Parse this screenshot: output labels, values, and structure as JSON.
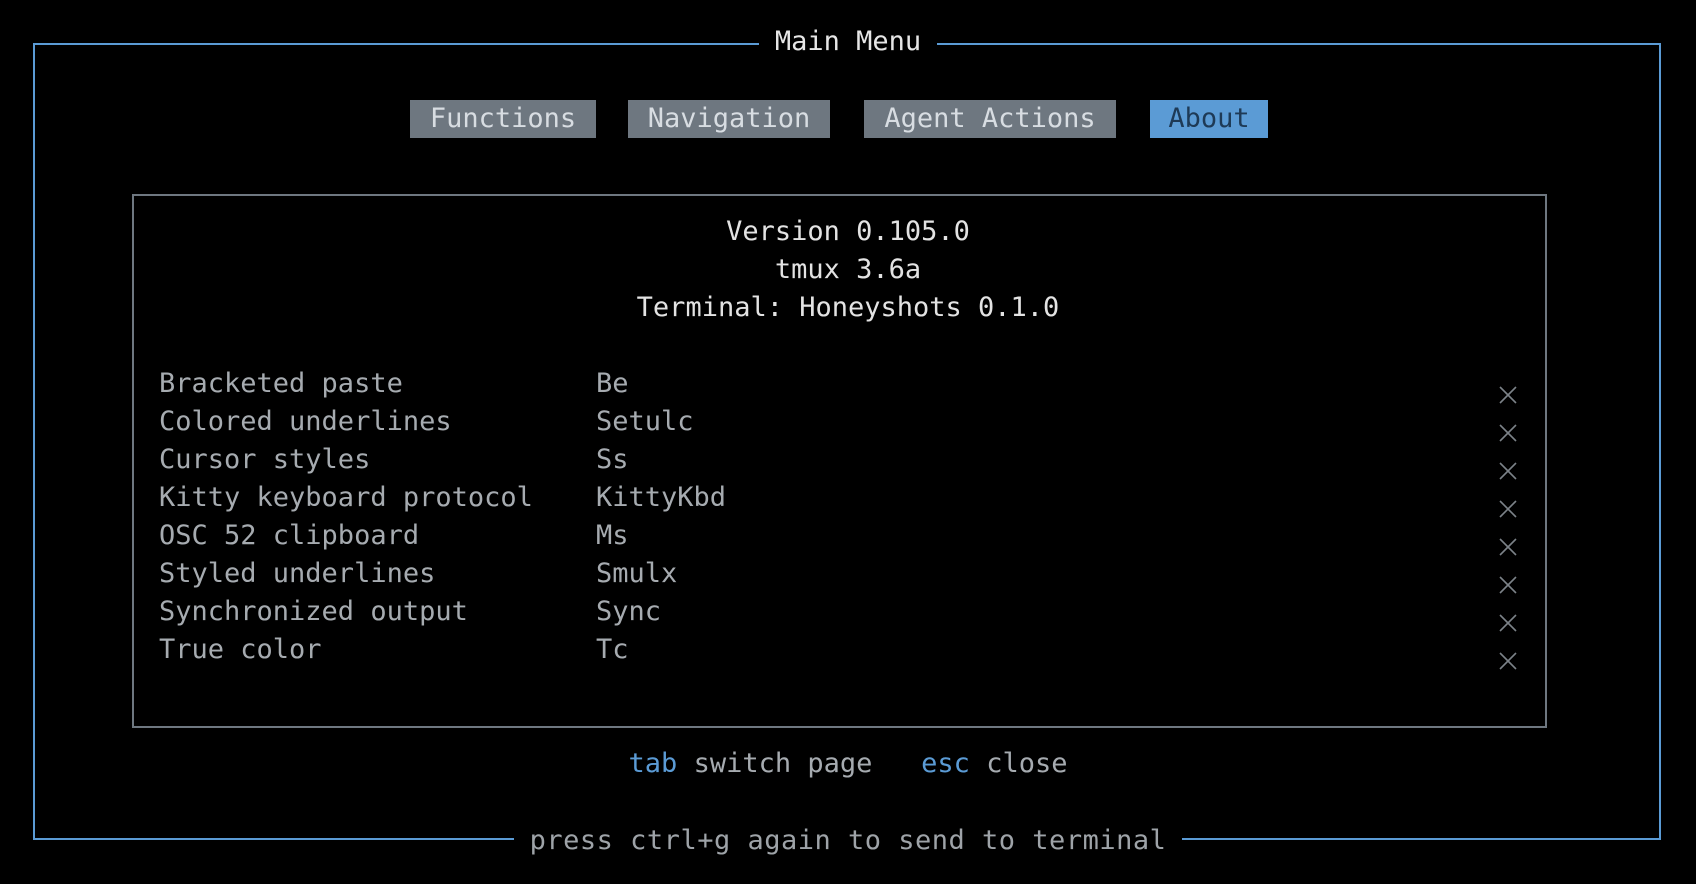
{
  "menu": {
    "title": "Main Menu",
    "footer": "press ctrl+g again to send to terminal"
  },
  "tabs": [
    {
      "label": "Functions",
      "active": false
    },
    {
      "label": "Navigation",
      "active": false
    },
    {
      "label": "Agent Actions",
      "active": false
    },
    {
      "label": "About",
      "active": true
    }
  ],
  "about": {
    "version": "Version 0.105.0",
    "tmux": "tmux 3.6a",
    "terminal": "Terminal: Honeyshots 0.1.0",
    "features": [
      {
        "name": "Bracketed paste",
        "capability": "Be",
        "status": "unsupported",
        "status_icon": "x-icon"
      },
      {
        "name": "Colored underlines",
        "capability": "Setulc",
        "status": "unsupported",
        "status_icon": "x-icon"
      },
      {
        "name": "Cursor styles",
        "capability": "Ss",
        "status": "unsupported",
        "status_icon": "x-icon"
      },
      {
        "name": "Kitty keyboard protocol",
        "capability": "KittyKbd",
        "status": "unsupported",
        "status_icon": "x-icon"
      },
      {
        "name": "OSC 52 clipboard",
        "capability": "Ms",
        "status": "unsupported",
        "status_icon": "x-icon"
      },
      {
        "name": "Styled underlines",
        "capability": "Smulx",
        "status": "unsupported",
        "status_icon": "x-icon"
      },
      {
        "name": "Synchronized output",
        "capability": "Sync",
        "status": "unsupported",
        "status_icon": "x-icon"
      },
      {
        "name": "True color",
        "capability": "Tc",
        "status": "unsupported",
        "status_icon": "x-icon"
      }
    ]
  },
  "hints": {
    "tab_key": "tab",
    "tab_action": "switch page",
    "esc_key": "esc",
    "esc_action": "close"
  },
  "colors": {
    "accent": "#5b9bd5",
    "tab_inactive_bg": "#6e7780",
    "background": "#000000"
  }
}
